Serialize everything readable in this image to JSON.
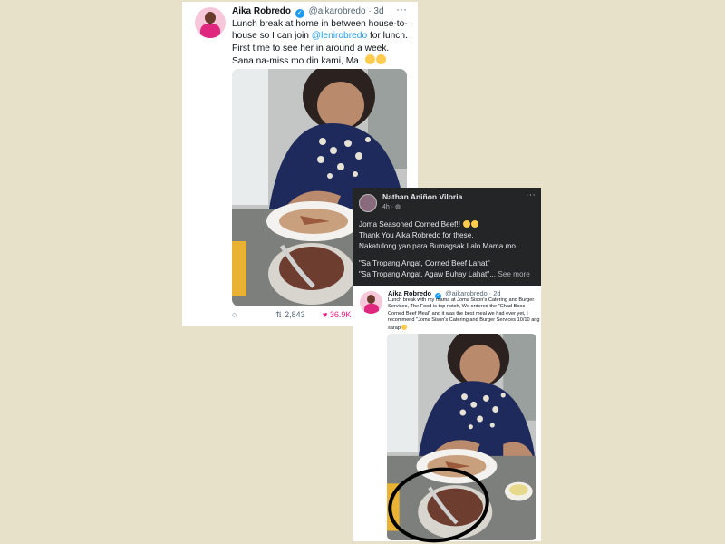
{
  "tweet": {
    "display_name": "Aika Robredo",
    "handle": "@aikarobredo",
    "time": "· 3d",
    "text_before_mention": "Lunch break at home in between house-to-house so I can join ",
    "mention": "@lenirobredo",
    "text_after_mention": " for lunch. First time to see her in around a week. Sana na-miss mo din kami, Ma.",
    "retweets": "2,843",
    "likes": "36.9K"
  },
  "fb_post": {
    "author": "Nathan Aniñon Viloria",
    "time": "4h · ",
    "lines": [
      "Joma Seasoned Corned Beef!!",
      "Thank You Aika Robredo for these.",
      "Nakatulong yan para Bumagsak Lalo Mama mo."
    ],
    "quote1": "\"Sa Tropang Angat, Corned Beef Lahat\"",
    "quote2": "\"Sa Tropang Angat, Agaw Buhay Lahat\"...",
    "see_more": "See more"
  },
  "shared_tweet": {
    "display_name": "Aika Robredo",
    "handle": "@aikarobredo",
    "time": "· 2d",
    "text": "Lunch break with my mama at Joma Sison's Catering and Burger Services, The Food is top notch, We ordered the \"Chad Booc Corned Beef Meal\" and it was the best meal we had ever yet, I recommend \"Joma Sison's Catering and Burger Services 10/10 ang sarap"
  },
  "icons": {
    "verified": "verified-badge-icon",
    "reply": "reply-icon",
    "retweet": "retweet-icon",
    "like": "heart-icon",
    "globe": "globe-icon",
    "more": "more-icon"
  },
  "colors": {
    "background": "#e7e1ca",
    "twitter_blue": "#1d9bf0",
    "like_pink": "#f91880",
    "fb_dark": "#242526",
    "shirt_navy": "#1f2a5c"
  }
}
